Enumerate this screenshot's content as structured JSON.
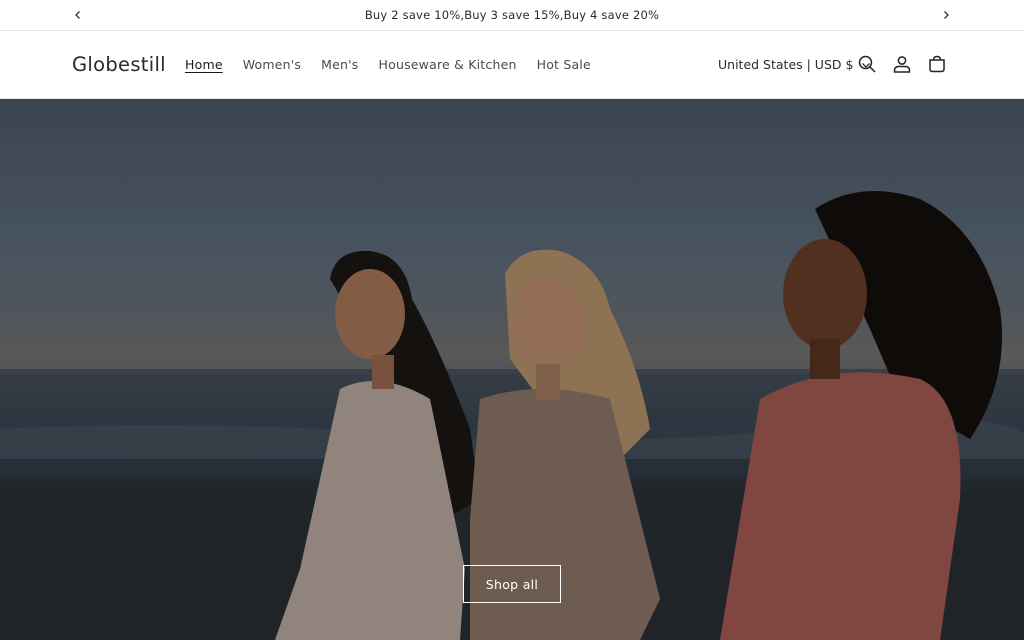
{
  "announcement": {
    "text": "Buy 2 save 10%,Buy 3 save 15%,Buy 4 save 20%",
    "prev_icon": "chevron-left-icon",
    "next_icon": "chevron-right-icon"
  },
  "header": {
    "logo": "Globestill",
    "nav": [
      {
        "label": "Home",
        "active": true
      },
      {
        "label": "Women's",
        "active": false
      },
      {
        "label": "Men's",
        "active": false
      },
      {
        "label": "Houseware & Kitchen",
        "active": false
      },
      {
        "label": "Hot Sale",
        "active": false
      }
    ],
    "locale": "United States | USD $",
    "icons": [
      "search-icon",
      "account-icon",
      "cart-icon"
    ]
  },
  "hero": {
    "image": "three women smiling on a beach at sunset",
    "button_label": "Shop all"
  },
  "colors": {
    "text": "#121212",
    "border": "#e6e6e6",
    "background": "#ffffff"
  }
}
